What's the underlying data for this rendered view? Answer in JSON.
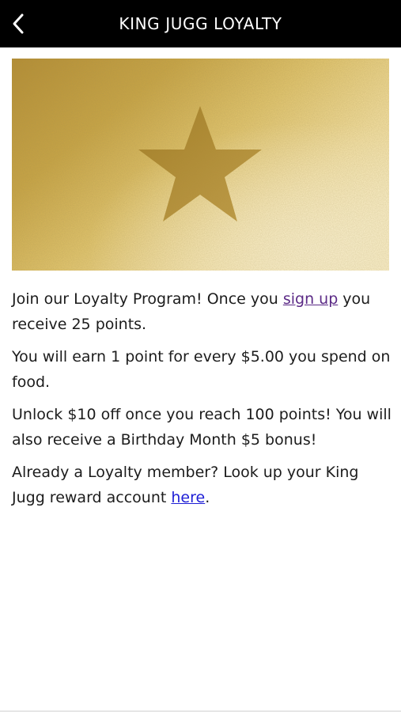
{
  "header": {
    "title": "KING JUGG LOYALTY",
    "back_icon": "chevron-left-icon"
  },
  "hero": {
    "icon": "star-icon",
    "colors": {
      "gold_light": "#fdf0c4",
      "gold_mid": "#d8b54e",
      "gold_dark": "#a8822b"
    }
  },
  "content": {
    "p1_before": "Join our Loyalty Program! Once you ",
    "p1_link": "sign up",
    "p1_after": " you receive 25 points.",
    "p2": "You will earn 1 point for every $5.00 you spend on food.",
    "p3": "Unlock $10 off once you reach 100 points! You will also receive a Birthday Month $5 bonus!",
    "p4_before": "Already a Loyalty member? Look up your King Jugg reward account ",
    "p4_link": "here",
    "p4_after": "."
  }
}
